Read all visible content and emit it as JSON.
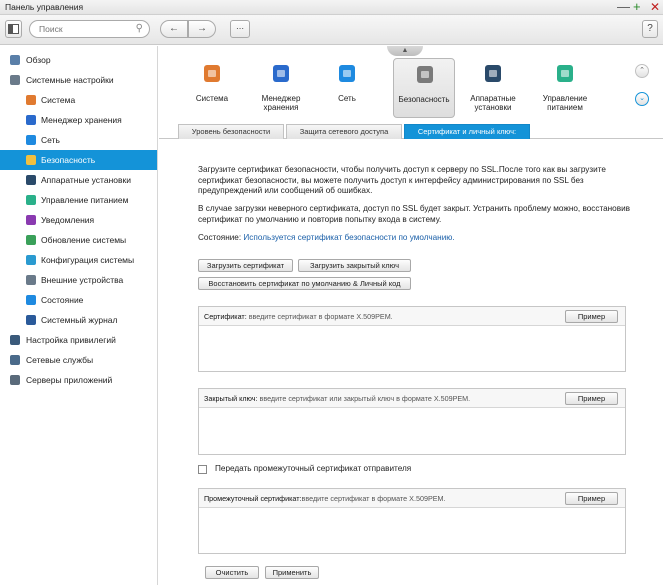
{
  "window": {
    "title": "Панель управления"
  },
  "toolbar": {
    "search_placeholder": "Поиск",
    "help_label": "?"
  },
  "sidebar": {
    "items": [
      {
        "label": "Обзор",
        "level": "top",
        "icon": "overview-icon",
        "color": "#5a7fa8"
      },
      {
        "label": "Системные настройки",
        "level": "top",
        "icon": "system-settings-icon",
        "color": "#6a7a8a"
      },
      {
        "label": "Система",
        "level": "sub",
        "icon": "system-icon",
        "color": "#e07a30"
      },
      {
        "label": "Менеджер хранения",
        "level": "sub",
        "icon": "storage-icon",
        "color": "#2a6acc"
      },
      {
        "label": "Сеть",
        "level": "sub",
        "icon": "network-icon",
        "color": "#1e8ae0"
      },
      {
        "label": "Безопасность",
        "level": "sub",
        "icon": "lock-icon",
        "color": "#f0c040",
        "active": true
      },
      {
        "label": "Аппаратные установки",
        "level": "sub",
        "icon": "hardware-icon",
        "color": "#2a4a6a"
      },
      {
        "label": "Управление питанием",
        "level": "sub",
        "icon": "power-icon",
        "color": "#2ab08a"
      },
      {
        "label": "Уведомления",
        "level": "sub",
        "icon": "notification-icon",
        "color": "#8a3ab0"
      },
      {
        "label": "Обновление системы",
        "level": "sub",
        "icon": "update-icon",
        "color": "#3aa05a"
      },
      {
        "label": "Конфигурация системы",
        "level": "sub",
        "icon": "configuration-icon",
        "color": "#2a9ad0"
      },
      {
        "label": "Внешние устройства",
        "level": "sub",
        "icon": "external-device-icon",
        "color": "#6a7a8a"
      },
      {
        "label": "Состояние",
        "level": "sub",
        "icon": "status-icon",
        "color": "#1e8ae0"
      },
      {
        "label": "Системный журнал",
        "level": "sub",
        "icon": "system-log-icon",
        "color": "#2a5a9a"
      },
      {
        "label": "Настройка привилегий",
        "level": "top",
        "icon": "privilege-icon",
        "color": "#3a5a7a"
      },
      {
        "label": "Сетевые службы",
        "level": "top",
        "icon": "network-services-icon",
        "color": "#4a6a8a"
      },
      {
        "label": "Серверы приложений",
        "level": "top",
        "icon": "app-servers-icon",
        "color": "#5a6a7a"
      }
    ]
  },
  "iconstrip": {
    "items": [
      {
        "label": "Система",
        "icon": "system-icon",
        "color": "#e07a30"
      },
      {
        "label": "Менеджер хранения",
        "icon": "storage-icon",
        "color": "#2a6acc"
      },
      {
        "label": "Сеть",
        "icon": "network-icon",
        "color": "#1e8ae0"
      },
      {
        "label": "Безопасность",
        "icon": "lock-icon",
        "color": "#7a7a7a",
        "selected": true
      },
      {
        "label": "Аппаратные установки",
        "icon": "hardware-icon",
        "color": "#2a4a6a"
      },
      {
        "label": "Управление питанием",
        "icon": "power-icon",
        "color": "#2ab08a"
      }
    ]
  },
  "tabs": [
    {
      "label": "Уровень безопасности"
    },
    {
      "label": "Защита сетевого доступа"
    },
    {
      "label": "Сертификат и личный ключ:",
      "active": true
    }
  ],
  "content": {
    "para1": "Загрузите сертификат безопасности, чтобы получить доступ к серверу по SSL.После того как вы загрузите сертификат безопасности, вы можете получить доступ к интерфейсу администрирования по SSL без предупреждений или сообщений об ошибках.",
    "para2": "В случае загрузки неверного сертификата, доступ по SSL будет закрыт. Устранить проблему можно, восстановив сертификат по умолчанию и повторив попытку входа в систему.",
    "state_label": "Состояние:",
    "state_value": "Используется сертификат безопасности по умолчанию.",
    "buttons": {
      "upload_cert": "Загрузить сертификат",
      "upload_key": "Загрузить закрытый ключ",
      "restore": "Восстановить сертификат по умолчанию & Личный код"
    },
    "cert": {
      "title": "Сертификат:",
      "hint": "введите сертификат в формате X.509PEM.",
      "example": "Пример"
    },
    "key": {
      "title": "Закрытый ключ:",
      "hint": "введите сертификат или закрытый ключ в формате X.509PEM.",
      "example": "Пример"
    },
    "checkbox": {
      "label": "Передать промежуточный сертификат отправителя",
      "checked": false
    },
    "intermediate": {
      "title": "Промежуточный сертификат:",
      "hint": "введите сертификат в формате X.509PEM.",
      "example": "Пример"
    },
    "clear_label": "Очистить",
    "apply_label": "Применить"
  }
}
